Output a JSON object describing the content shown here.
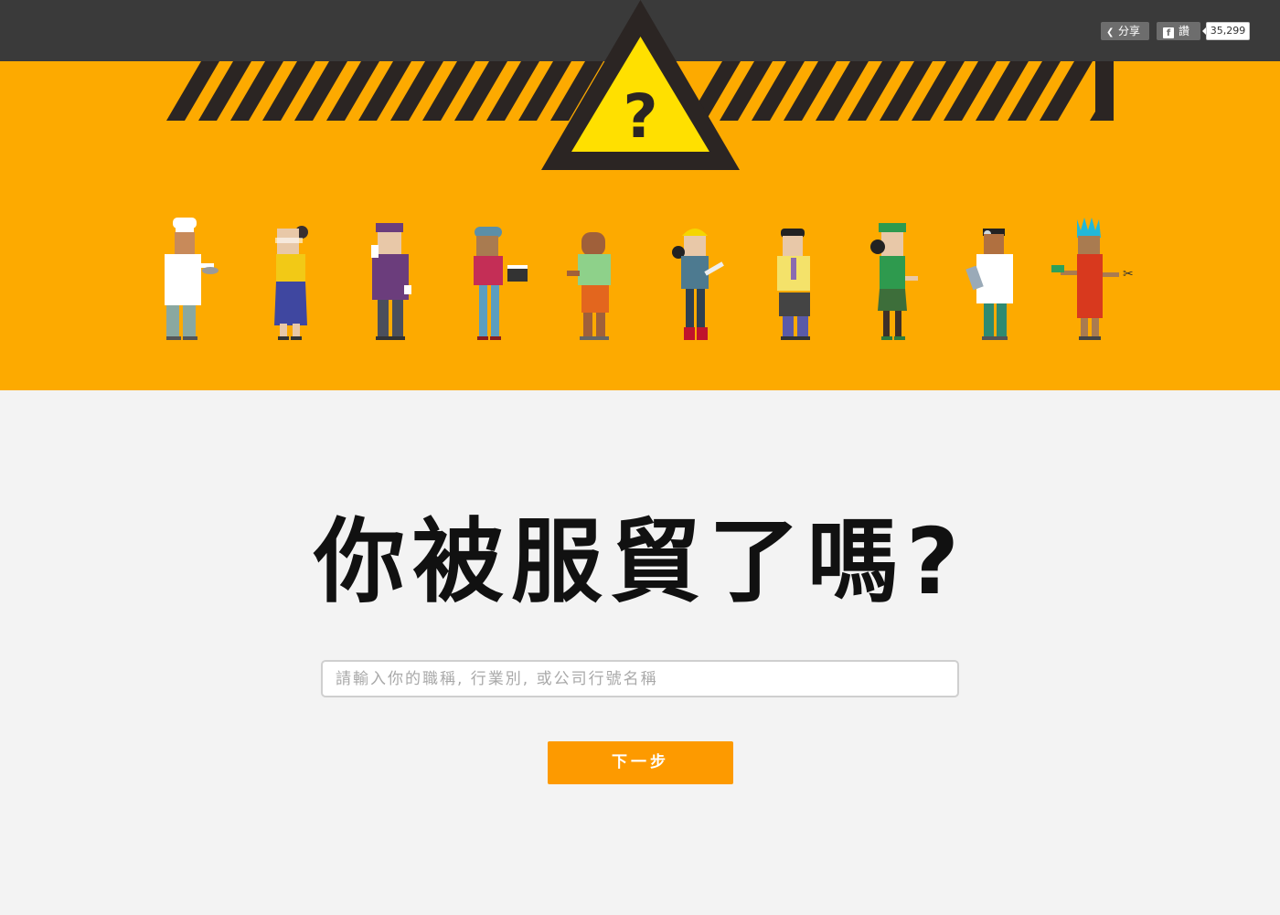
{
  "header": {
    "share_label": "分享",
    "like_label": "讚",
    "like_count": "35,299",
    "warning_symbol": "?",
    "share_icon": "share-icon",
    "facebook_icon": "facebook-icon"
  },
  "hero": {
    "characters": [
      "chef",
      "office-lady",
      "bellhop",
      "film-director",
      "worker",
      "construction-engineer",
      "businessman",
      "store-clerk",
      "doctor",
      "hairdresser"
    ]
  },
  "main": {
    "title": "你被服貿了嗎?",
    "search_placeholder": "請輸入你的職稱, 行業別, 或公司行號名稱",
    "next_label": "下一步"
  },
  "colors": {
    "topbar": "#3a3a3a",
    "hero": "#fdaa00",
    "stripes": "#2b2523",
    "warning_fill": "#ffe000",
    "button": "#fd9a00",
    "background": "#f3f3f3"
  }
}
